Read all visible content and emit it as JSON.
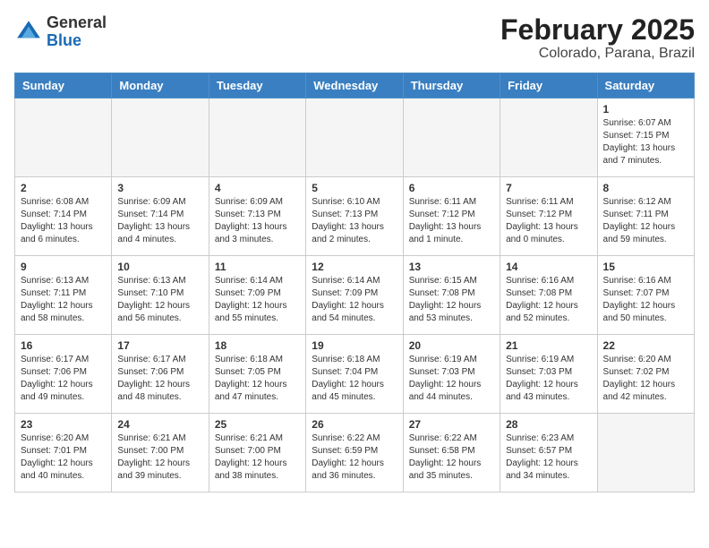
{
  "logo": {
    "general": "General",
    "blue": "Blue"
  },
  "title": "February 2025",
  "subtitle": "Colorado, Parana, Brazil",
  "days_of_week": [
    "Sunday",
    "Monday",
    "Tuesday",
    "Wednesday",
    "Thursday",
    "Friday",
    "Saturday"
  ],
  "weeks": [
    [
      {
        "day": "",
        "empty": true
      },
      {
        "day": "",
        "empty": true
      },
      {
        "day": "",
        "empty": true
      },
      {
        "day": "",
        "empty": true
      },
      {
        "day": "",
        "empty": true
      },
      {
        "day": "",
        "empty": true
      },
      {
        "day": "1",
        "sunrise": "6:07 AM",
        "sunset": "7:15 PM",
        "daylight": "13 hours and 7 minutes."
      }
    ],
    [
      {
        "day": "2",
        "sunrise": "6:08 AM",
        "sunset": "7:14 PM",
        "daylight": "13 hours and 6 minutes."
      },
      {
        "day": "3",
        "sunrise": "6:09 AM",
        "sunset": "7:14 PM",
        "daylight": "13 hours and 4 minutes."
      },
      {
        "day": "4",
        "sunrise": "6:09 AM",
        "sunset": "7:13 PM",
        "daylight": "13 hours and 3 minutes."
      },
      {
        "day": "5",
        "sunrise": "6:10 AM",
        "sunset": "7:13 PM",
        "daylight": "13 hours and 2 minutes."
      },
      {
        "day": "6",
        "sunrise": "6:11 AM",
        "sunset": "7:12 PM",
        "daylight": "13 hours and 1 minute."
      },
      {
        "day": "7",
        "sunrise": "6:11 AM",
        "sunset": "7:12 PM",
        "daylight": "13 hours and 0 minutes."
      },
      {
        "day": "8",
        "sunrise": "6:12 AM",
        "sunset": "7:11 PM",
        "daylight": "12 hours and 59 minutes."
      }
    ],
    [
      {
        "day": "9",
        "sunrise": "6:13 AM",
        "sunset": "7:11 PM",
        "daylight": "12 hours and 58 minutes."
      },
      {
        "day": "10",
        "sunrise": "6:13 AM",
        "sunset": "7:10 PM",
        "daylight": "12 hours and 56 minutes."
      },
      {
        "day": "11",
        "sunrise": "6:14 AM",
        "sunset": "7:09 PM",
        "daylight": "12 hours and 55 minutes."
      },
      {
        "day": "12",
        "sunrise": "6:14 AM",
        "sunset": "7:09 PM",
        "daylight": "12 hours and 54 minutes."
      },
      {
        "day": "13",
        "sunrise": "6:15 AM",
        "sunset": "7:08 PM",
        "daylight": "12 hours and 53 minutes."
      },
      {
        "day": "14",
        "sunrise": "6:16 AM",
        "sunset": "7:08 PM",
        "daylight": "12 hours and 52 minutes."
      },
      {
        "day": "15",
        "sunrise": "6:16 AM",
        "sunset": "7:07 PM",
        "daylight": "12 hours and 50 minutes."
      }
    ],
    [
      {
        "day": "16",
        "sunrise": "6:17 AM",
        "sunset": "7:06 PM",
        "daylight": "12 hours and 49 minutes."
      },
      {
        "day": "17",
        "sunrise": "6:17 AM",
        "sunset": "7:06 PM",
        "daylight": "12 hours and 48 minutes."
      },
      {
        "day": "18",
        "sunrise": "6:18 AM",
        "sunset": "7:05 PM",
        "daylight": "12 hours and 47 minutes."
      },
      {
        "day": "19",
        "sunrise": "6:18 AM",
        "sunset": "7:04 PM",
        "daylight": "12 hours and 45 minutes."
      },
      {
        "day": "20",
        "sunrise": "6:19 AM",
        "sunset": "7:03 PM",
        "daylight": "12 hours and 44 minutes."
      },
      {
        "day": "21",
        "sunrise": "6:19 AM",
        "sunset": "7:03 PM",
        "daylight": "12 hours and 43 minutes."
      },
      {
        "day": "22",
        "sunrise": "6:20 AM",
        "sunset": "7:02 PM",
        "daylight": "12 hours and 42 minutes."
      }
    ],
    [
      {
        "day": "23",
        "sunrise": "6:20 AM",
        "sunset": "7:01 PM",
        "daylight": "12 hours and 40 minutes."
      },
      {
        "day": "24",
        "sunrise": "6:21 AM",
        "sunset": "7:00 PM",
        "daylight": "12 hours and 39 minutes."
      },
      {
        "day": "25",
        "sunrise": "6:21 AM",
        "sunset": "7:00 PM",
        "daylight": "12 hours and 38 minutes."
      },
      {
        "day": "26",
        "sunrise": "6:22 AM",
        "sunset": "6:59 PM",
        "daylight": "12 hours and 36 minutes."
      },
      {
        "day": "27",
        "sunrise": "6:22 AM",
        "sunset": "6:58 PM",
        "daylight": "12 hours and 35 minutes."
      },
      {
        "day": "28",
        "sunrise": "6:23 AM",
        "sunset": "6:57 PM",
        "daylight": "12 hours and 34 minutes."
      },
      {
        "day": "",
        "empty": true
      }
    ]
  ]
}
